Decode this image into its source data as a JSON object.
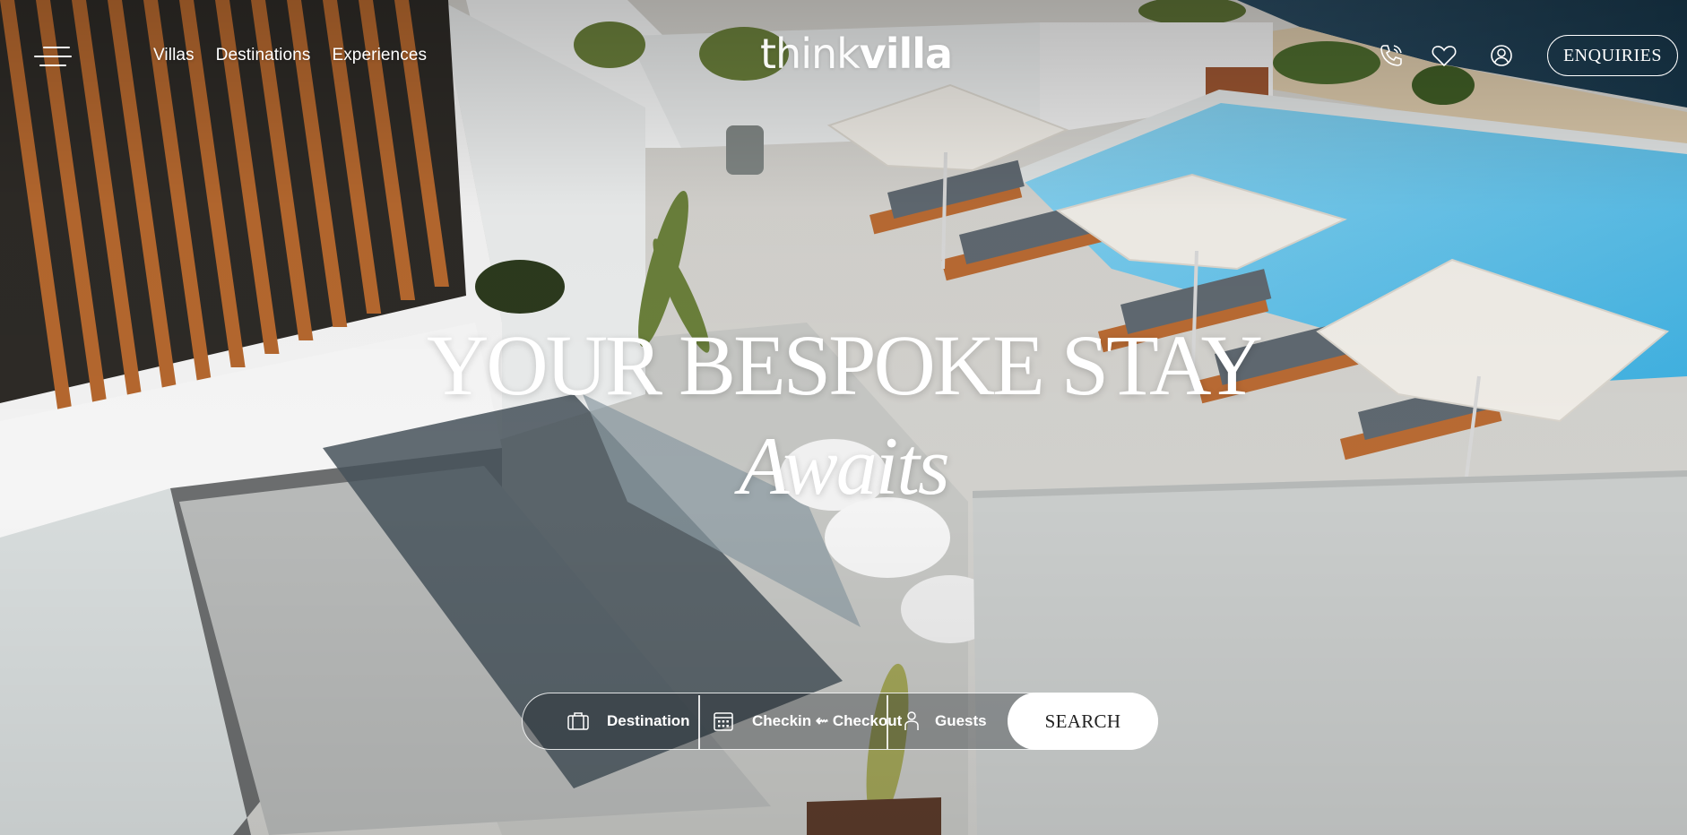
{
  "header": {
    "menu_icon": "hamburger-menu-icon",
    "nav": [
      {
        "label": "Villas"
      },
      {
        "label": "Destinations"
      },
      {
        "label": "Experiences"
      }
    ],
    "logo": {
      "light": "think",
      "bold": "villa"
    },
    "icons": [
      "phone-icon",
      "heart-icon",
      "user-icon"
    ],
    "enquiries_label": "ENQUIRIES"
  },
  "hero": {
    "title": "YOUR BESPOKE STAY",
    "subtitle": "Awaits"
  },
  "search": {
    "destination_label": "Destination",
    "dates_label": "Checkin ⇜ Checkout",
    "guests_label": "Guests",
    "button_label": "SEARCH",
    "icons": [
      "suitcase-icon",
      "calendar-icon",
      "person-icon"
    ]
  },
  "colors": {
    "text": "#ffffff",
    "pool": "#5fc1e6",
    "wood": "#b5652a",
    "stone": "#dcdfdf"
  }
}
